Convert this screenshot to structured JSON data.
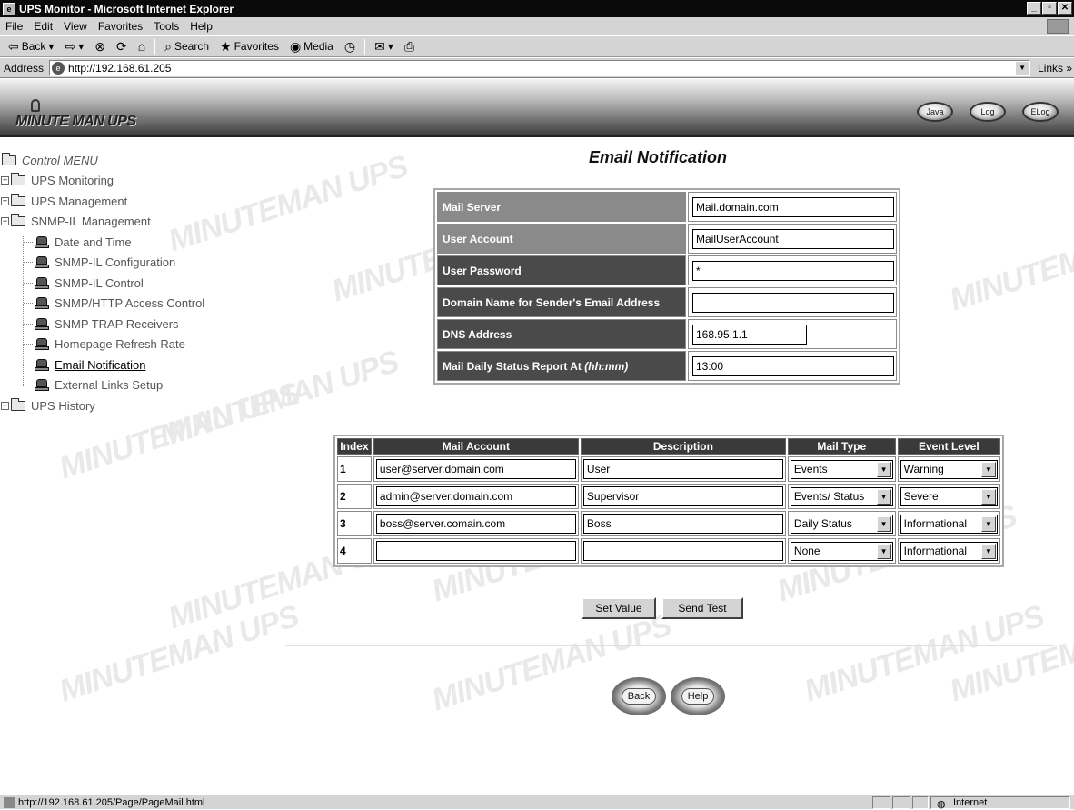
{
  "window": {
    "title": "UPS Monitor - Microsoft Internet Explorer",
    "menu": [
      "File",
      "Edit",
      "View",
      "Favorites",
      "Tools",
      "Help"
    ],
    "toolbar": {
      "back": "Back",
      "search": "Search",
      "favorites": "Favorites",
      "media": "Media"
    },
    "address_label": "Address",
    "address_url": "http://192.168.61.205",
    "links_label": "Links »",
    "status_url": "http://192.168.61.205/Page/PageMail.html",
    "status_zone": "Internet"
  },
  "banner": {
    "brand": "MINUTE MAN UPS",
    "buttons": [
      "Java",
      "Log",
      "ELog"
    ]
  },
  "watermark": "MINUTEMAN UPS",
  "tree": {
    "root": "Control MENU",
    "items": [
      {
        "label": "UPS Monitoring"
      },
      {
        "label": "UPS Management"
      },
      {
        "label": "SNMP-IL Management"
      },
      {
        "label": "Date and Time"
      },
      {
        "label": "SNMP-IL Configuration"
      },
      {
        "label": "SNMP-IL Control"
      },
      {
        "label": "SNMP/HTTP Access Control"
      },
      {
        "label": "SNMP TRAP Receivers"
      },
      {
        "label": "Homepage Refresh Rate"
      },
      {
        "label": "Email Notification"
      },
      {
        "label": "External Links Setup"
      },
      {
        "label": "UPS History"
      }
    ]
  },
  "page": {
    "title": "Email Notification",
    "config": [
      {
        "label": "Mail Server",
        "value": "Mail.domain.com"
      },
      {
        "label": "User Account",
        "value": "MailUserAccount"
      },
      {
        "label": "User Password",
        "value": "*"
      },
      {
        "label": "Domain Name for Sender's Email Address",
        "value": ""
      },
      {
        "label": "DNS Address",
        "value": "168.95.1.1"
      },
      {
        "label": "Mail Daily Status Report At ",
        "label_em": "(hh:mm)",
        "value": "13:00"
      }
    ],
    "mail_table": {
      "headers": [
        "Index",
        "Mail Account",
        "Description",
        "Mail Type",
        "Event Level"
      ],
      "rows": [
        {
          "index": "1",
          "account": "user@server.domain.com",
          "description": "User",
          "type": "Events",
          "level": "Warning"
        },
        {
          "index": "2",
          "account": "admin@server.domain.com",
          "description": "Supervisor",
          "type": "Events/ Status",
          "level": "Severe"
        },
        {
          "index": "3",
          "account": "boss@server.comain.com",
          "description": "Boss",
          "type": "Daily Status",
          "level": "Informational"
        },
        {
          "index": "4",
          "account": "",
          "description": "",
          "type": "None",
          "level": "Informational"
        }
      ]
    },
    "buttons": {
      "set_value": "Set Value",
      "send_test": "Send Test",
      "back": "Back",
      "help": "Help"
    }
  }
}
